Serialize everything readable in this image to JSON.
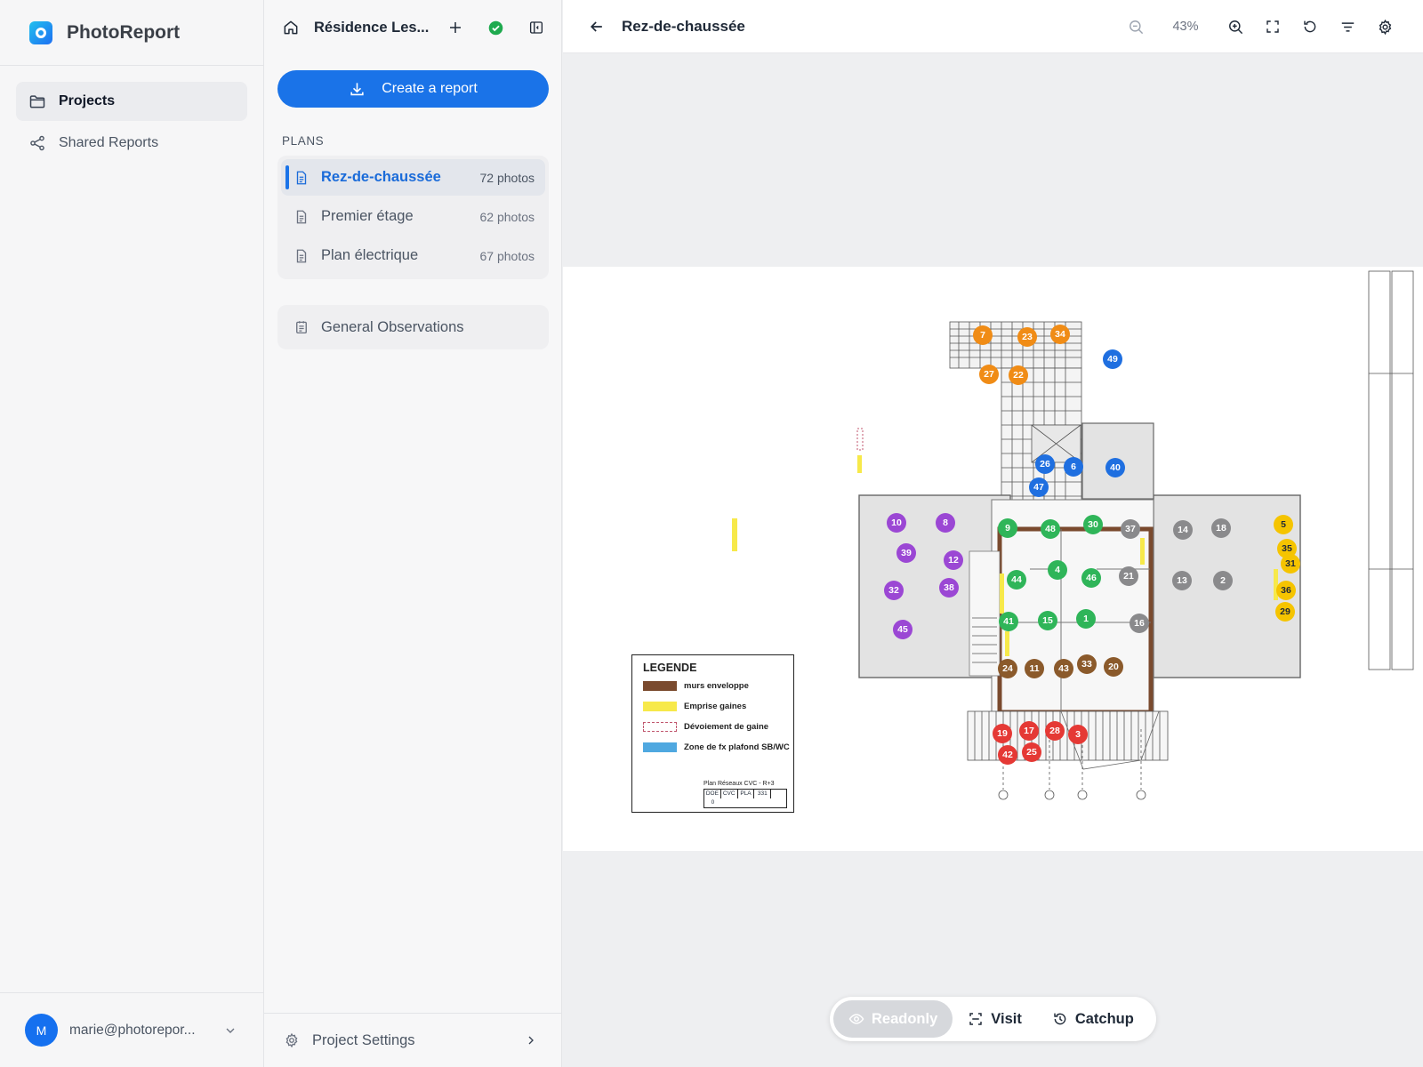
{
  "app": {
    "name": "PhotoReport"
  },
  "sidebar": {
    "items": [
      {
        "label": "Projects",
        "icon": "folder-icon",
        "active": true
      },
      {
        "label": "Shared Reports",
        "icon": "share-icon",
        "active": false
      }
    ],
    "user": {
      "initial": "M",
      "email": "marie@photorepor..."
    }
  },
  "project": {
    "name": "Résidence Les...",
    "status_color": "#1faa4f",
    "create_report_label": "Create a report",
    "plans_heading": "PLANS",
    "plans": [
      {
        "name": "Rez-de-chaussée",
        "count": "72 photos",
        "active": true
      },
      {
        "name": "Premier étage",
        "count": "62 photos",
        "active": false
      },
      {
        "name": "Plan électrique",
        "count": "67 photos",
        "active": false
      }
    ],
    "observations_label": "General Observations",
    "settings_label": "Project Settings"
  },
  "viewer": {
    "title": "Rez-de-chaussée",
    "zoom": "43%",
    "modes": [
      {
        "label": "Readonly",
        "icon": "eye-icon",
        "active": true
      },
      {
        "label": "Visit",
        "icon": "scan-icon",
        "active": false
      },
      {
        "label": "Catchup",
        "icon": "history-icon",
        "active": false
      }
    ],
    "legend": {
      "title": "LEGENDE",
      "items": [
        {
          "label": "murs enveloppe",
          "color": "#7a4a2e",
          "style": "solid"
        },
        {
          "label": "Emprise gaines",
          "color": "#f7e94a",
          "style": "solid"
        },
        {
          "label": "Dévoiement de gaine",
          "color": "#c0566d",
          "style": "dashed"
        },
        {
          "label": "Zone de fx plafond SB/WC",
          "color": "#4fa8e0",
          "style": "solid"
        }
      ],
      "cartouche": "Plan Réseaux CVC - R+3",
      "cartouche_cells": [
        "DOE",
        "CVC",
        "PLA",
        "331",
        "0"
      ]
    },
    "marker_colors": {
      "orange": "#f08c16",
      "blue": "#1f6fe0",
      "purple": "#9b47d4",
      "green": "#2fb559",
      "gray": "#8a8a8c",
      "yellow": "#f5c400",
      "brown": "#8b5a2b",
      "red": "#e53935"
    },
    "markers": [
      {
        "n": "7",
        "c": "orange"
      },
      {
        "n": "23",
        "c": "orange"
      },
      {
        "n": "34",
        "c": "orange"
      },
      {
        "n": "27",
        "c": "orange"
      },
      {
        "n": "22",
        "c": "orange"
      },
      {
        "n": "49",
        "c": "blue"
      },
      {
        "n": "26",
        "c": "blue"
      },
      {
        "n": "6",
        "c": "blue"
      },
      {
        "n": "40",
        "c": "blue"
      },
      {
        "n": "47",
        "c": "blue"
      },
      {
        "n": "10",
        "c": "purple"
      },
      {
        "n": "8",
        "c": "purple"
      },
      {
        "n": "39",
        "c": "purple"
      },
      {
        "n": "12",
        "c": "purple"
      },
      {
        "n": "32",
        "c": "purple"
      },
      {
        "n": "38",
        "c": "purple"
      },
      {
        "n": "45",
        "c": "purple"
      },
      {
        "n": "9",
        "c": "green"
      },
      {
        "n": "48",
        "c": "green"
      },
      {
        "n": "30",
        "c": "green"
      },
      {
        "n": "44",
        "c": "green"
      },
      {
        "n": "4",
        "c": "green"
      },
      {
        "n": "46",
        "c": "green"
      },
      {
        "n": "41",
        "c": "green"
      },
      {
        "n": "15",
        "c": "green"
      },
      {
        "n": "1",
        "c": "green"
      },
      {
        "n": "37",
        "c": "gray"
      },
      {
        "n": "21",
        "c": "gray"
      },
      {
        "n": "16",
        "c": "gray"
      },
      {
        "n": "14",
        "c": "gray"
      },
      {
        "n": "18",
        "c": "gray"
      },
      {
        "n": "13",
        "c": "gray"
      },
      {
        "n": "2",
        "c": "gray"
      },
      {
        "n": "5",
        "c": "yellow"
      },
      {
        "n": "35",
        "c": "yellow"
      },
      {
        "n": "31",
        "c": "yellow"
      },
      {
        "n": "36",
        "c": "yellow"
      },
      {
        "n": "29",
        "c": "yellow"
      },
      {
        "n": "24",
        "c": "brown"
      },
      {
        "n": "11",
        "c": "brown"
      },
      {
        "n": "43",
        "c": "brown"
      },
      {
        "n": "33",
        "c": "brown"
      },
      {
        "n": "20",
        "c": "brown"
      },
      {
        "n": "19",
        "c": "red"
      },
      {
        "n": "17",
        "c": "red"
      },
      {
        "n": "28",
        "c": "red"
      },
      {
        "n": "3",
        "c": "red"
      },
      {
        "n": "42",
        "c": "red"
      },
      {
        "n": "25",
        "c": "red"
      }
    ]
  }
}
